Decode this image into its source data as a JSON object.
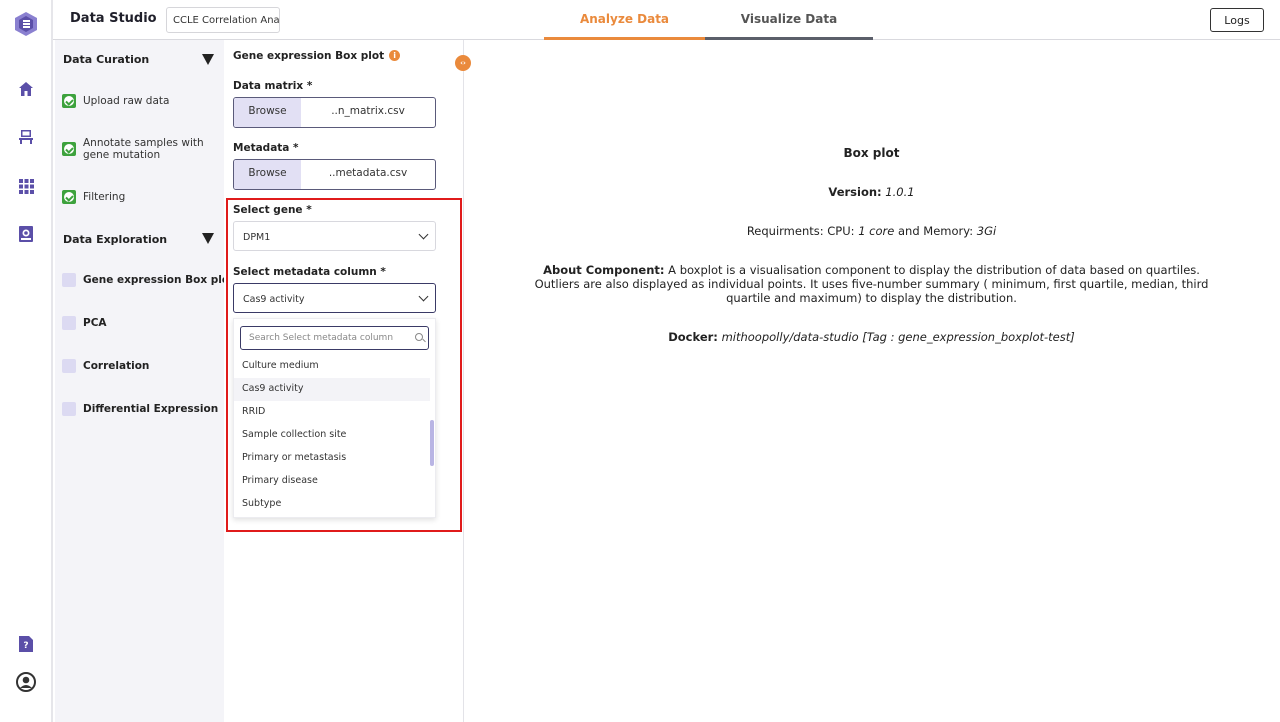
{
  "header": {
    "app_title": "Data Studio",
    "project_name": "CCLE Correlation Anal",
    "tabs": [
      {
        "label": "Analyze Data",
        "active": true
      },
      {
        "label": "Visualize Data",
        "active": false
      }
    ],
    "logs_label": "Logs",
    "accent_color": "#ea8a3c"
  },
  "rail": {
    "icons": [
      "logo-icon",
      "home-icon",
      "workbench-icon",
      "apps-grid-icon",
      "container-icon",
      "help-icon",
      "user-icon"
    ],
    "icon_color": "#5b4fa8"
  },
  "curation": {
    "sections": [
      {
        "title": "Data Curation",
        "steps": [
          {
            "label": "Upload raw data",
            "status": "done"
          },
          {
            "label": "Annotate samples with gene mutation",
            "status": "done"
          },
          {
            "label": "Filtering",
            "status": "done"
          }
        ]
      },
      {
        "title": "Data Exploration",
        "steps": [
          {
            "label": "Gene expression Box plot",
            "status": "current"
          },
          {
            "label": "PCA",
            "status": "todo"
          },
          {
            "label": "Correlation",
            "status": "todo"
          },
          {
            "label": "Differential Expression",
            "status": "todo"
          }
        ]
      }
    ]
  },
  "form": {
    "title": "Gene expression Box plot",
    "info_glyph": "i",
    "data_matrix": {
      "label": "Data matrix *",
      "browse": "Browse",
      "filename": "..n_matrix.csv"
    },
    "metadata": {
      "label": "Metadata *",
      "browse": "Browse",
      "filename": "..metadata.csv"
    },
    "gene": {
      "label": "Select gene *",
      "value": "DPM1"
    },
    "metadata_column": {
      "label": "Select metadata column *",
      "value": "Cas9 activity",
      "search_placeholder": "Search Select metadata column",
      "options": [
        "Culture medium",
        "Cas9 activity",
        "RRID",
        "Sample collection site",
        "Primary or metastasis",
        "Primary disease",
        "Subtype"
      ],
      "selected_index": 1
    }
  },
  "toggle_glyph": "‹›",
  "component_info": {
    "title": "Box plot",
    "version_label": "Version:",
    "version": "1.0.1",
    "req_prefix": "Requirments: CPU:",
    "cpu": "1 core",
    "req_mid": "and Memory:",
    "memory": "3Gi",
    "about_label": "About Component:",
    "about_text": "A boxplot is a visualisation component to display the distribution of data based on quartiles. Outliers are also displayed as individual points. It uses five-number summary ( minimum, first quartile, median, third quartile and maximum) to display the distribution.",
    "docker_label": "Docker:",
    "docker_image": "mithoopolly/data-studio [Tag : gene_expression_boxplot-test]"
  }
}
